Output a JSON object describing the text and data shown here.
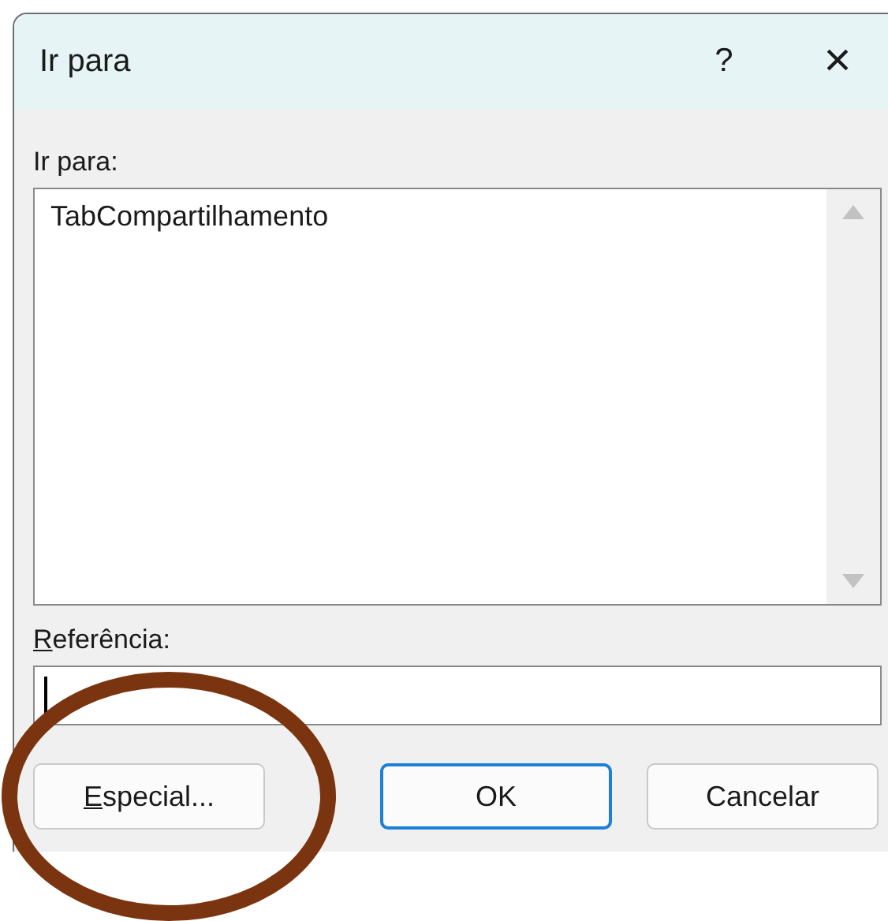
{
  "window": {
    "title": "Ir para",
    "help": "?",
    "close": "×"
  },
  "goto_list": {
    "label": "Ir para:",
    "items": [
      {
        "text": "TabCompartilhamento",
        "selected": false
      }
    ]
  },
  "reference": {
    "label": "Referência:"
  },
  "buttons": [
    {
      "label": "Especial...",
      "default": false
    },
    {
      "label": "OK",
      "default": true
    },
    {
      "label": "Cancelar",
      "default": false
    }
  ],
  "annotation": {
    "kind": "ellipse",
    "color": "#7b3410"
  }
}
